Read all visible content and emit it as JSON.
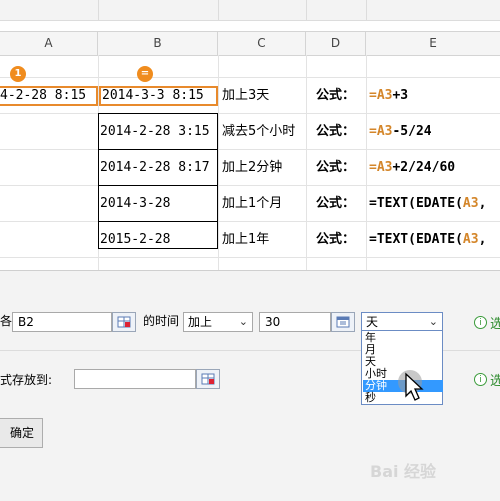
{
  "columns": [
    "A",
    "B",
    "C",
    "D",
    "E"
  ],
  "badges": {
    "a": "1",
    "b": "="
  },
  "rows": [
    {
      "a": "4-2-28 8:15",
      "b": "2014-3-3  8:15",
      "c": "加上3天",
      "d": "公式：",
      "e_prefix": "=",
      "e_ref": "A3",
      "e_suffix": "+3"
    },
    {
      "a": "",
      "b": "2014-2-28  3:15",
      "c": "减去5个小时",
      "d": "公式：",
      "e_prefix": "=",
      "e_ref": "A3",
      "e_suffix": "-5/24"
    },
    {
      "a": "",
      "b": "2014-2-28  8:17",
      "c": "加上2分钟",
      "d": "公式：",
      "e_prefix": "=",
      "e_ref": "A3",
      "e_suffix": "+2/24/60"
    },
    {
      "a": "",
      "b": "2014-3-28",
      "c": "加上1个月",
      "d": "公式：",
      "e_prefix": "=TEXT(EDATE(",
      "e_ref": "A3",
      "e_suffix": ","
    },
    {
      "a": "",
      "b": "2015-2-28",
      "c": "加上1年",
      "d": "公式：",
      "e_prefix": "=TEXT(EDATE(",
      "e_ref": "A3",
      "e_suffix": ","
    }
  ],
  "dialog": {
    "row1": {
      "prefix": "各",
      "cell_value": "B2",
      "label_time": "的时间",
      "operation": "加上",
      "amount": "30",
      "unit": "天",
      "unit_options": [
        "年",
        "月",
        "天",
        "小时",
        "分钟",
        "秒"
      ],
      "highlighted_option": "分钟",
      "info_text": "选"
    },
    "row2": {
      "label": "式存放到:",
      "value": "",
      "info_text": "选"
    },
    "confirm_label": "确定"
  },
  "watermark": "Bai 经验"
}
